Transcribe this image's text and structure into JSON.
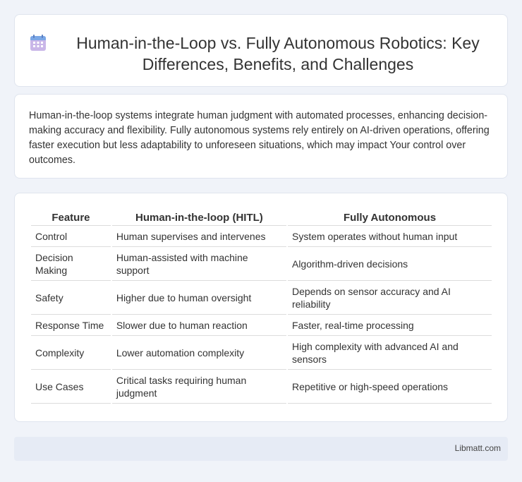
{
  "header": {
    "icon": "calendar-icon",
    "title": "Human-in-the-Loop vs. Fully Autonomous Robotics: Key Differences, Benefits, and Challenges"
  },
  "intro": {
    "text": "Human-in-the-loop systems integrate human judgment with automated processes, enhancing decision-making accuracy and flexibility. Fully autonomous systems rely entirely on AI-driven operations, offering faster execution but less adaptability to unforeseen situations, which may impact Your control over outcomes."
  },
  "table": {
    "headers": [
      "Feature",
      "Human-in-the-loop (HITL)",
      "Fully Autonomous"
    ],
    "rows": [
      [
        "Control",
        "Human supervises and intervenes",
        "System operates without human input"
      ],
      [
        "Decision Making",
        "Human-assisted with machine support",
        "Algorithm-driven decisions"
      ],
      [
        "Safety",
        "Higher due to human oversight",
        "Depends on sensor accuracy and AI reliability"
      ],
      [
        "Response Time",
        "Slower due to human reaction",
        "Faster, real-time processing"
      ],
      [
        "Complexity",
        "Lower automation complexity",
        "High complexity with advanced AI and sensors"
      ],
      [
        "Use Cases",
        "Critical tasks requiring human judgment",
        "Repetitive or high-speed operations"
      ]
    ]
  },
  "footer": {
    "brand": "Libmatt.com"
  }
}
